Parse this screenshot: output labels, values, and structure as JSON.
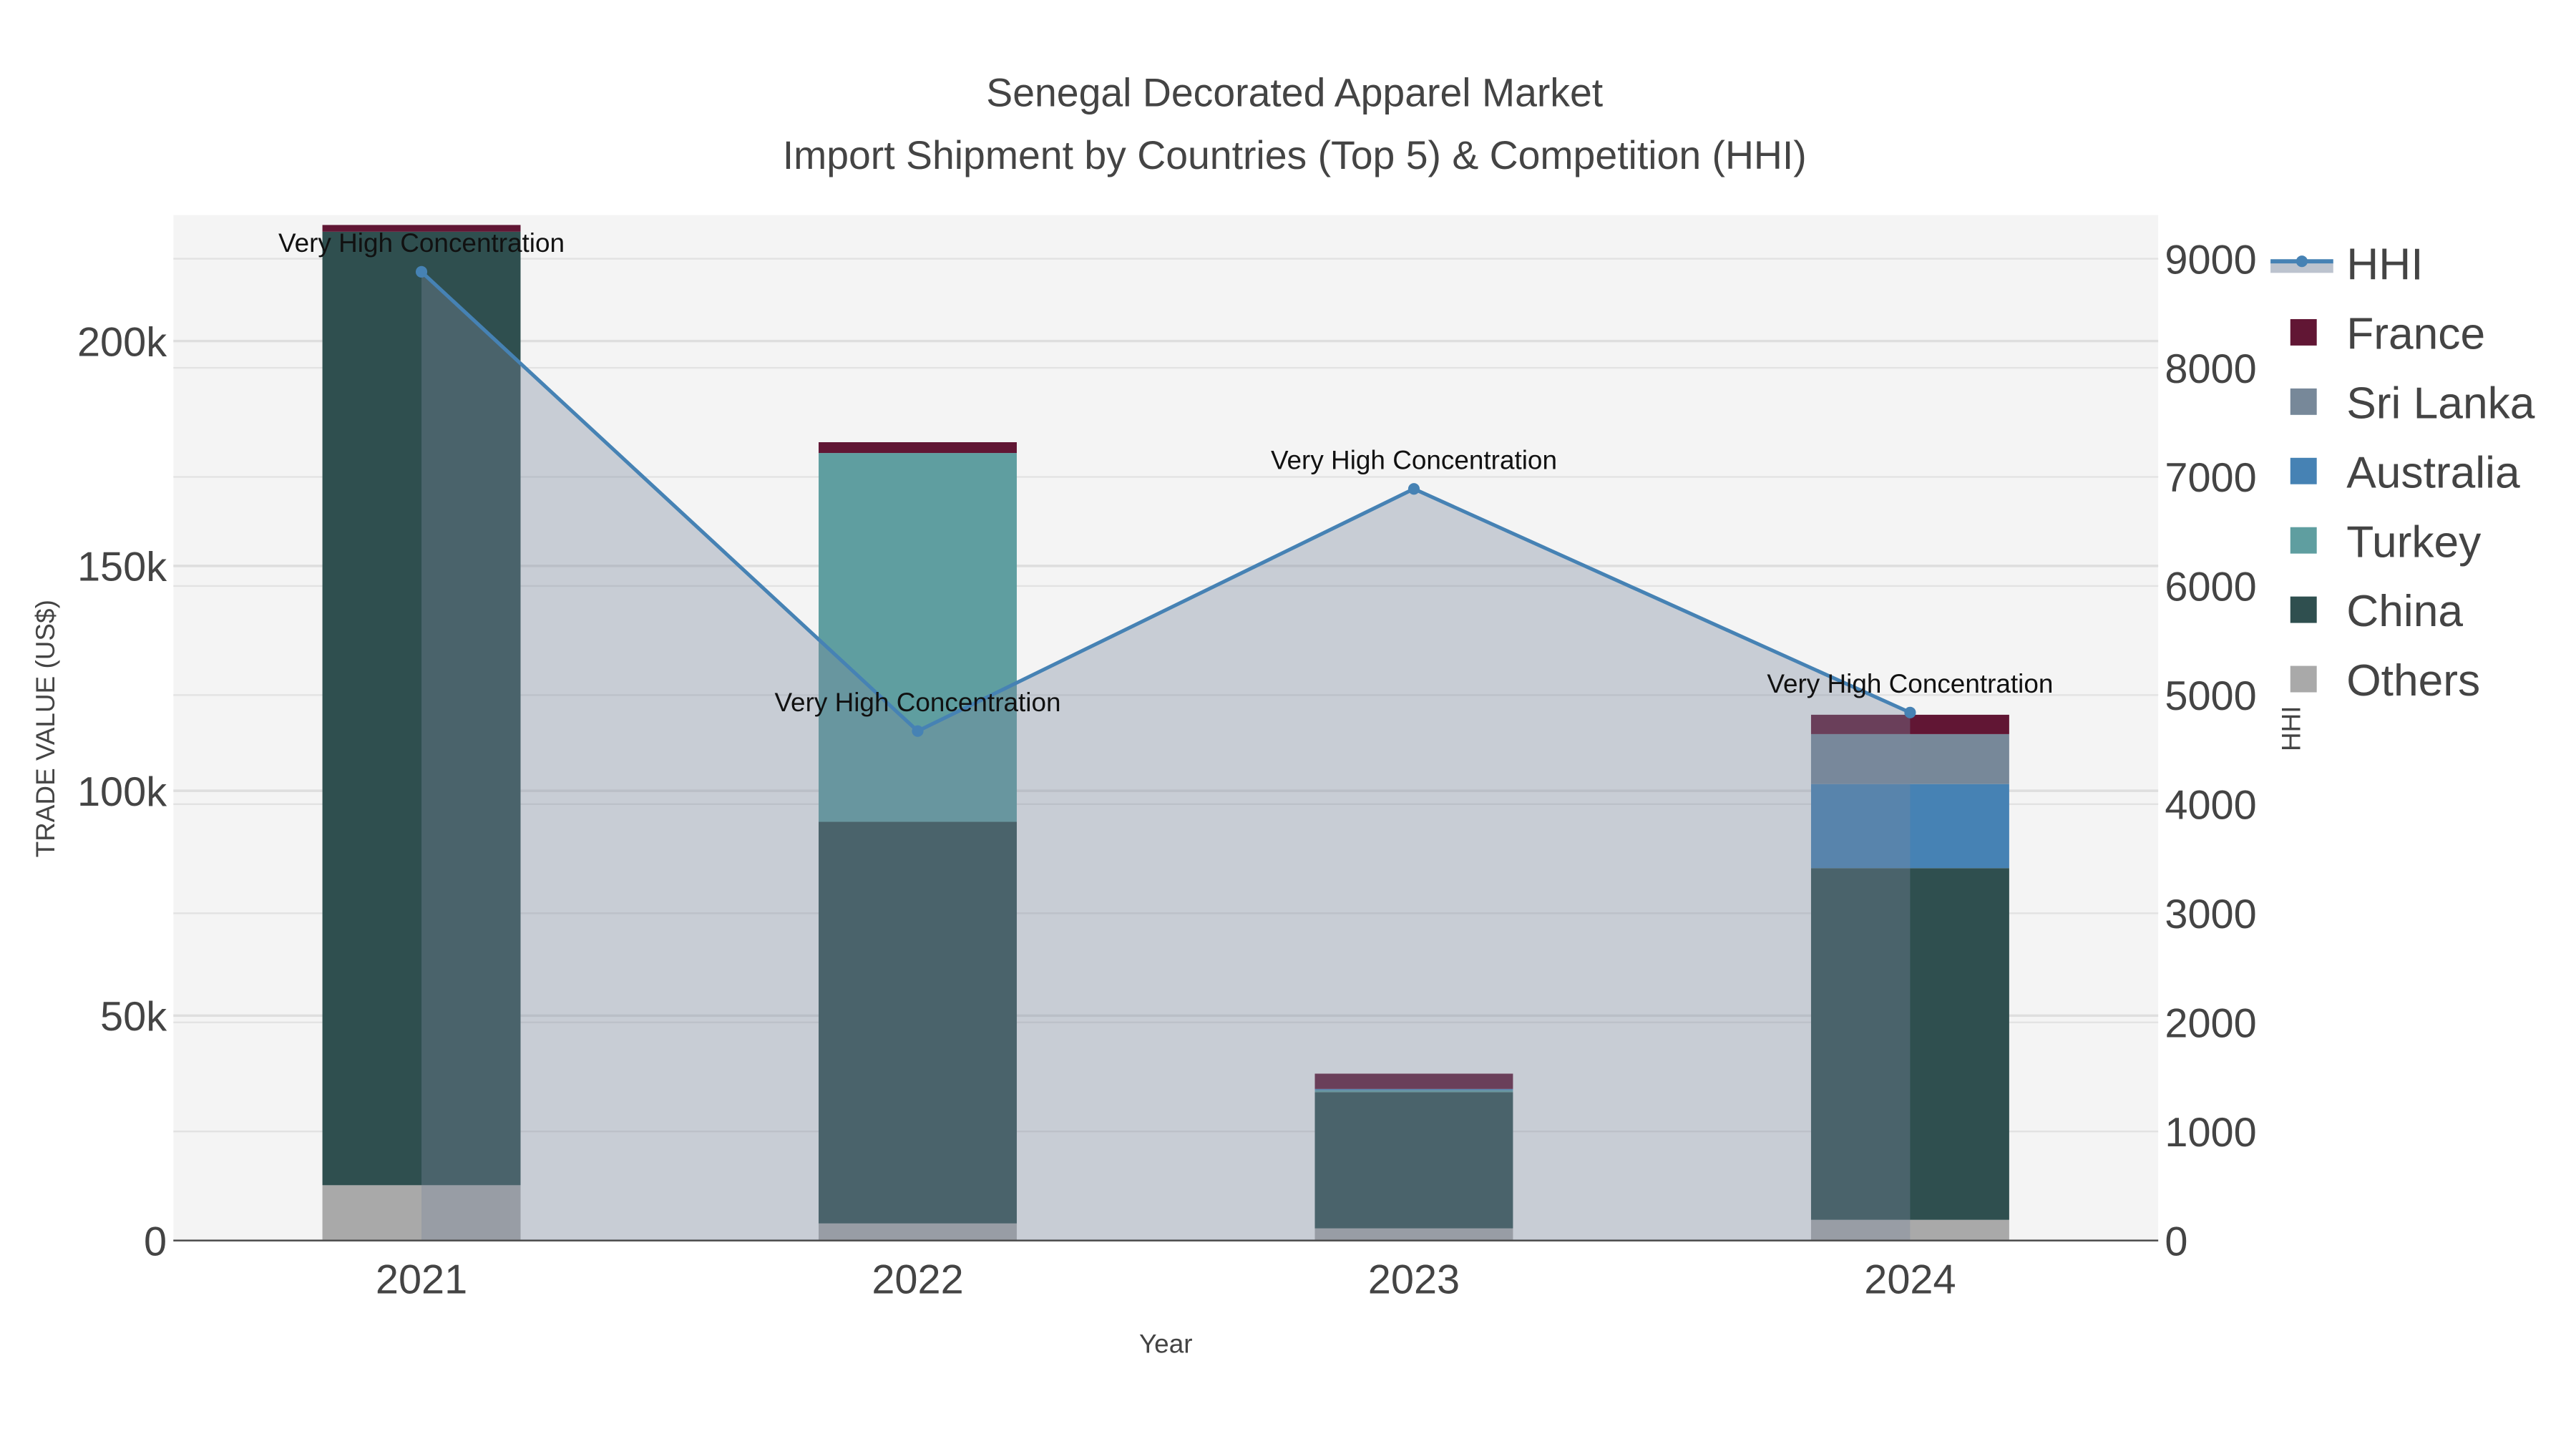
{
  "chart_data": {
    "type": "bar",
    "barmode": "stack",
    "title": "Senegal Decorated Apparel Market",
    "subtitle": "Import Shipment by Countries (Top 5) & Competition (HHI)",
    "xlabel": "Year",
    "ylabel": "TRADE VALUE (US$)",
    "y2label": "HHI",
    "categories": [
      "2021",
      "2022",
      "2023",
      "2024"
    ],
    "ylim": [
      0,
      228000
    ],
    "y2lim": [
      0,
      9400
    ],
    "yticks": [
      0,
      50000,
      100000,
      150000,
      200000
    ],
    "ytick_labels": [
      "0",
      "50k",
      "100k",
      "150k",
      "200k"
    ],
    "y2ticks": [
      0,
      1000,
      2000,
      3000,
      4000,
      5000,
      6000,
      7000,
      8000,
      9000
    ],
    "y2tick_labels": [
      "0",
      "1000",
      "2000",
      "3000",
      "4000",
      "5000",
      "6000",
      "7000",
      "8000",
      "9000"
    ],
    "series": [
      {
        "name": "Others",
        "color": "#a9a9a9",
        "values": [
          12300,
          3800,
          2700,
          4600
        ]
      },
      {
        "name": "China",
        "color": "#2f4f4f",
        "values": [
          212000,
          89300,
          30300,
          78200
        ]
      },
      {
        "name": "Turkey",
        "color": "#5f9ea0",
        "values": [
          0,
          82000,
          400,
          0
        ]
      },
      {
        "name": "Australia",
        "color": "#4682b4",
        "values": [
          0,
          0,
          300,
          18700
        ]
      },
      {
        "name": "Sri Lanka",
        "color": "#778899",
        "values": [
          0,
          0,
          0,
          11100
        ]
      },
      {
        "name": "France",
        "color": "#611634",
        "values": [
          1500,
          2400,
          3400,
          4300
        ]
      }
    ],
    "line": {
      "name": "HHI",
      "color": "#4682b4",
      "axis": "right",
      "values": [
        8880,
        4670,
        6890,
        4840
      ]
    },
    "annotations": [
      "Very High Concentration",
      "Very High Concentration",
      "Very High Concentration",
      "Very High Concentration"
    ],
    "legend_order": [
      "HHI",
      "France",
      "Sri Lanka",
      "Australia",
      "Turkey",
      "China",
      "Others"
    ],
    "legend_position": "right",
    "grid": true
  }
}
